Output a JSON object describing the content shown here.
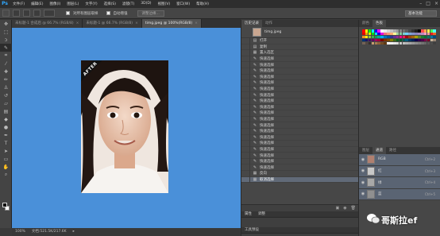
{
  "app": {
    "logo": "Ps"
  },
  "menu": [
    "文件(F)",
    "编辑(E)",
    "图像(I)",
    "图层(L)",
    "文字(Y)",
    "选择(S)",
    "滤镜(T)",
    "3D(D)",
    "视图(V)",
    "窗口(W)",
    "帮助(H)"
  ],
  "options_bar": {
    "checkbox1_label": "对所有图层取样",
    "checkbox2_label": "自动增强",
    "button_label": "调整边缘...",
    "workspace": "基本功能"
  },
  "tabs": [
    {
      "label": "未标题-1 合成后 @ 66.7% (RGB/8)",
      "active": false
    },
    {
      "label": "未标题-1 @ 66.7% (RGB/8)",
      "active": false
    },
    {
      "label": "timg.jpeg @ 100%(RGB/8)",
      "active": true
    }
  ],
  "photo": {
    "badge": "AFTER"
  },
  "status": {
    "zoom": "100%",
    "doc": "文档:521.5K/217.6K"
  },
  "history": {
    "tabs": [
      "历史记录",
      "动作"
    ],
    "snapshot": "timg.jpeg",
    "rows": [
      {
        "icon": "open-icon",
        "label": "打开"
      },
      {
        "icon": "copy-icon",
        "label": "复制"
      },
      {
        "icon": "layer-icon",
        "label": "置入选区"
      },
      {
        "icon": "quick-select-icon",
        "label": "快速选择"
      },
      {
        "icon": "quick-select-icon",
        "label": "快速选择"
      },
      {
        "icon": "quick-select-icon",
        "label": "快速选择"
      },
      {
        "icon": "quick-select-icon",
        "label": "快速选择"
      },
      {
        "icon": "quick-select-icon",
        "label": "快速选择"
      },
      {
        "icon": "quick-select-icon",
        "label": "快速选择"
      },
      {
        "icon": "quick-select-icon",
        "label": "快速选择"
      },
      {
        "icon": "quick-select-icon",
        "label": "快速选择"
      },
      {
        "icon": "quick-select-icon",
        "label": "快速选择"
      },
      {
        "icon": "quick-select-icon",
        "label": "快速选择"
      },
      {
        "icon": "quick-select-icon",
        "label": "快速选择"
      },
      {
        "icon": "quick-select-icon",
        "label": "快速选择"
      },
      {
        "icon": "quick-select-icon",
        "label": "快速选择"
      },
      {
        "icon": "quick-select-icon",
        "label": "快速选择"
      },
      {
        "icon": "quick-select-icon",
        "label": "快速选择"
      },
      {
        "icon": "quick-select-icon",
        "label": "快速选择"
      },
      {
        "icon": "quick-select-icon",
        "label": "快速选择"
      },
      {
        "icon": "quick-select-icon",
        "label": "快速选择"
      },
      {
        "icon": "quick-select-icon",
        "label": "快速选择"
      },
      {
        "icon": "invert-icon",
        "label": "反向"
      },
      {
        "icon": "deselect-icon",
        "label": "取消选择",
        "selected": true
      }
    ]
  },
  "props_panel": {
    "tabs": [
      "属性",
      "调整"
    ],
    "title": "工具预设"
  },
  "swatches": {
    "tabs": [
      "颜色",
      "色板"
    ],
    "colors": [
      "#ff0000",
      "#ffff00",
      "#00ff00",
      "#00ffff",
      "#0000ff",
      "#ff00ff",
      "#ffffff",
      "#ebebeb",
      "#d6d6d6",
      "#c2c2c2",
      "#adadad",
      "#999999",
      "#858585",
      "#707070",
      "#5c5c5c",
      "#474747",
      "#333333",
      "#1f1f1f",
      "#000000",
      "#ff4d4d",
      "#ffa64d",
      "#ffff4d",
      "#4dff4d",
      "#4dffff",
      "#e60000",
      "#e6a800",
      "#e6e600",
      "#00e600",
      "#00e6e6",
      "#0000e6",
      "#e600e6",
      "#f26d7d",
      "#f7977a",
      "#fbad73",
      "#fff79a",
      "#a2d39c",
      "#82ca9d",
      "#7bcdc8",
      "#6ecff6",
      "#7ea7d8",
      "#8493ca",
      "#8882be",
      "#a187be",
      "#bc8dbf",
      "#f49ac2",
      "#f6989d",
      "#ed1c24",
      "#f26522",
      "#f7941d",
      "#fff200",
      "#8dc63f",
      "#39b54a",
      "#00a651",
      "#00a99d",
      "#00aeef",
      "#0072bc",
      "#0054a6",
      "#2e3192",
      "#662d91",
      "#92278f",
      "#ec008c",
      "#ed145b",
      "#9e0b0f",
      "#a0410d",
      "#a3620a",
      "#aba000",
      "#598527",
      "#1a7b30",
      "#007236",
      "#00746b",
      "#0076a3",
      "#004b80",
      "#003471",
      "#1b1464",
      "#440e62",
      "#630460",
      "#9e005d",
      "#9e0039",
      "#790000",
      "#7b2e00",
      "#7d4900",
      "#827b00",
      "#406618",
      "#005e20",
      "#005826",
      "#005952",
      "#005b7f",
      "#003663",
      "#002157",
      "#0d004c",
      "#32004b",
      "#4b0049",
      "#7b0046",
      "#7a0026",
      "#c7b299",
      "#998675",
      "#736357",
      "#534741",
      "#37302a",
      "#c69c6d",
      "#a67c52",
      "#8c6239",
      "#754c24",
      "#603913",
      "#ffffff",
      "#f2f2f2",
      "#e6e6e6",
      "#d9d9d9",
      "#cccccc",
      "#bfbfbf",
      "#b3b3b3",
      "#a6a6a6",
      "#999999",
      "#8c8c8c",
      "#808080",
      "#737373",
      "#666666",
      "#595959",
      "#4d4d4d",
      "#404040"
    ]
  },
  "channels": {
    "tabs": [
      "图层",
      "通道",
      "路径"
    ],
    "rows": [
      {
        "label": "RGB",
        "shortcut": "Ctrl+2",
        "selected": true
      },
      {
        "label": "红",
        "shortcut": "Ctrl+3",
        "selected": true
      },
      {
        "label": "绿",
        "shortcut": "Ctrl+4",
        "selected": true
      },
      {
        "label": "蓝",
        "shortcut": "Ctrl+5",
        "selected": true
      }
    ]
  },
  "watermark": {
    "text": "哥斯拉ef"
  },
  "colors": {
    "canvas_bg": "#4a90d9",
    "accent": "#31a8ff",
    "selected_row": "#616a78"
  }
}
